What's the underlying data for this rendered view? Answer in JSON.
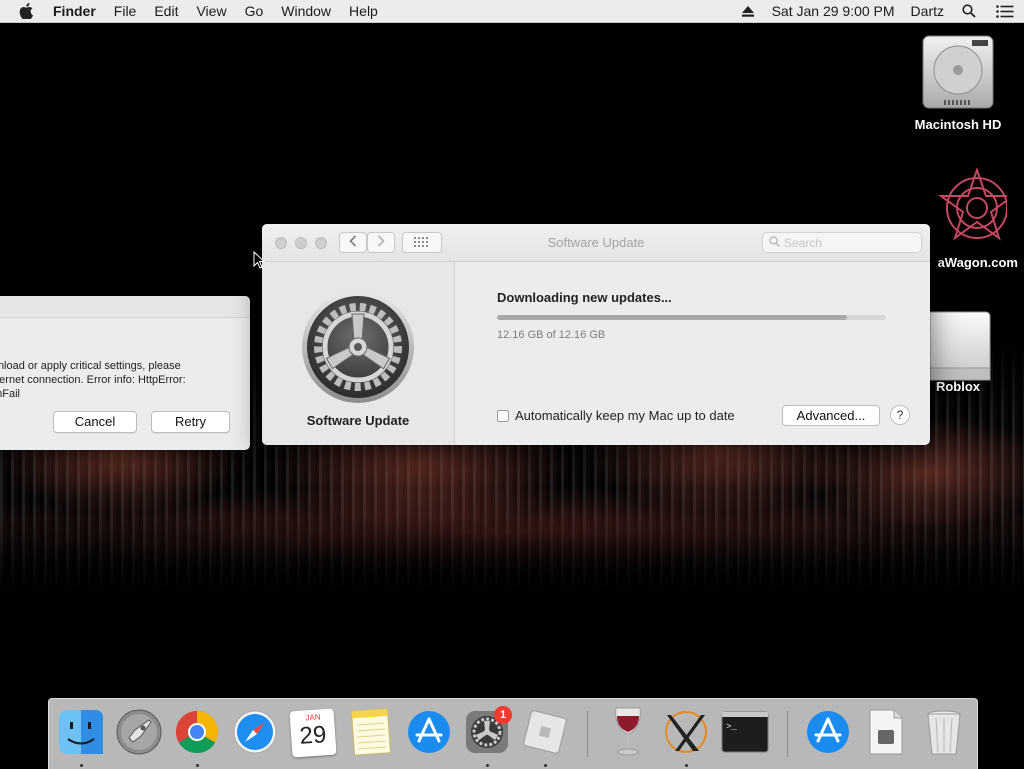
{
  "menubar": {
    "app_name": "Finder",
    "menus": [
      "File",
      "Edit",
      "View",
      "Go",
      "Window",
      "Help"
    ],
    "clock": "Sat Jan 29  9:00 PM",
    "user": "Dartz"
  },
  "desktop_icons": {
    "macintosh_hd": "Macintosh HD",
    "wagon": "aWagon.com",
    "roblox": "Roblox"
  },
  "error_dialog": {
    "message": "wnload or apply critical settings, please\nnternet connection. Error info: HttpError:\nonFail",
    "cancel_label": "Cancel",
    "retry_label": "Retry"
  },
  "software_update": {
    "window_title": "Software Update",
    "search_placeholder": "Search",
    "pane_name": "Software Update",
    "status": "Downloading new updates...",
    "progress_fraction": 0.9,
    "size_text": "12.16 GB of 12.16 GB",
    "auto_update_label": "Automatically keep my Mac up to date",
    "auto_update_checked": false,
    "advanced_label": "Advanced...",
    "help_label": "?"
  },
  "dock": {
    "apps": [
      "finder-icon",
      "launchpad-icon",
      "chrome-icon",
      "safari-icon",
      "calendar-icon",
      "notes-icon",
      "app-store-icon",
      "system-preferences-icon",
      "roblox-icon",
      "wine-icon",
      "xquartz-icon",
      "terminal-icon",
      "app-store-downloads-icon",
      "file-icon",
      "trash-icon"
    ],
    "calendar_month": "JAN",
    "calendar_day": "29",
    "sys_prefs_badge": "1"
  }
}
